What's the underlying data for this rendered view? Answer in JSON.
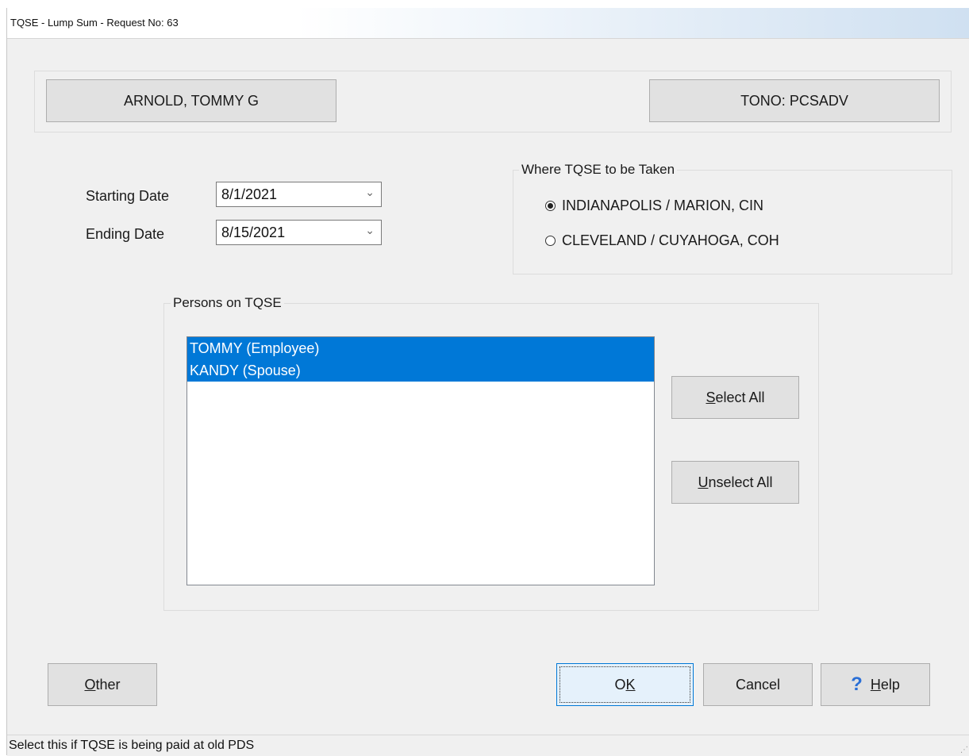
{
  "window": {
    "title": "TQSE - Lump Sum - Request No: 63"
  },
  "header": {
    "employee_name": "ARNOLD, TOMMY G",
    "tono": "TONO: PCSADV"
  },
  "dates": {
    "starting_label": "Starting Date",
    "starting_value": "8/1/2021",
    "ending_label": "Ending Date",
    "ending_value": "8/15/2021"
  },
  "location": {
    "caption": "Where TQSE to be Taken",
    "options": [
      {
        "label": "INDIANAPOLIS / MARION, CIN",
        "checked": true
      },
      {
        "label": "CLEVELAND / CUYAHOGA, COH",
        "checked": false
      }
    ]
  },
  "persons": {
    "caption": "Persons on TQSE",
    "items": [
      {
        "label": "TOMMY (Employee)",
        "selected": true
      },
      {
        "label": "KANDY (Spouse)",
        "selected": true
      }
    ],
    "select_all_mnemonic": "S",
    "select_all_rest": "elect All",
    "unselect_all_mnemonic": "U",
    "unselect_all_rest": "nselect All"
  },
  "footer": {
    "other_mnemonic": "O",
    "other_rest": "ther",
    "ok_pre": "O",
    "ok_mnemonic": "K",
    "cancel_label": "Cancel",
    "help_mnemonic": "H",
    "help_rest": "elp",
    "help_icon": "?"
  },
  "status": {
    "text": "Select this if TQSE is being paid at old PDS"
  },
  "icons": {
    "dropdown": "chevron-down-icon",
    "help": "help-icon"
  }
}
